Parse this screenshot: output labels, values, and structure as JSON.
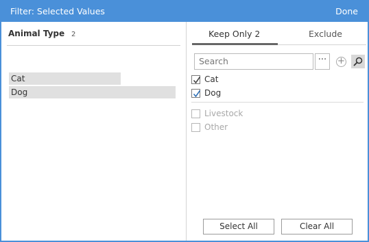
{
  "dialog": {
    "title": "Filter: Selected Values",
    "done_label": "Done"
  },
  "left": {
    "field_name": "Animal Type",
    "field_count": "2",
    "selected": [
      "Cat",
      "Dog"
    ]
  },
  "tabs": {
    "keep_only_label": "Keep Only",
    "keep_only_count": "2",
    "exclude_label": "Exclude"
  },
  "search": {
    "placeholder": "Search",
    "more_label": "···",
    "add_label": "+"
  },
  "values": {
    "checked": [
      {
        "label": "Cat",
        "checked": true
      },
      {
        "label": "Dog",
        "checked": true
      }
    ],
    "unchecked": [
      {
        "label": "Livestock",
        "checked": false
      },
      {
        "label": "Other",
        "checked": false
      }
    ]
  },
  "buttons": {
    "select_all": "Select All",
    "clear_all": "Clear All"
  },
  "colors": {
    "title_bar": "#4a90d9",
    "selected_bg": "#e0e0e0",
    "check_mark": "#2e6fb5",
    "disabled_text": "#a8a8a8"
  },
  "icons": {
    "search_button": "magnifier-icon",
    "add_button": "plus-circle-icon",
    "more_button": "ellipsis-icon"
  }
}
